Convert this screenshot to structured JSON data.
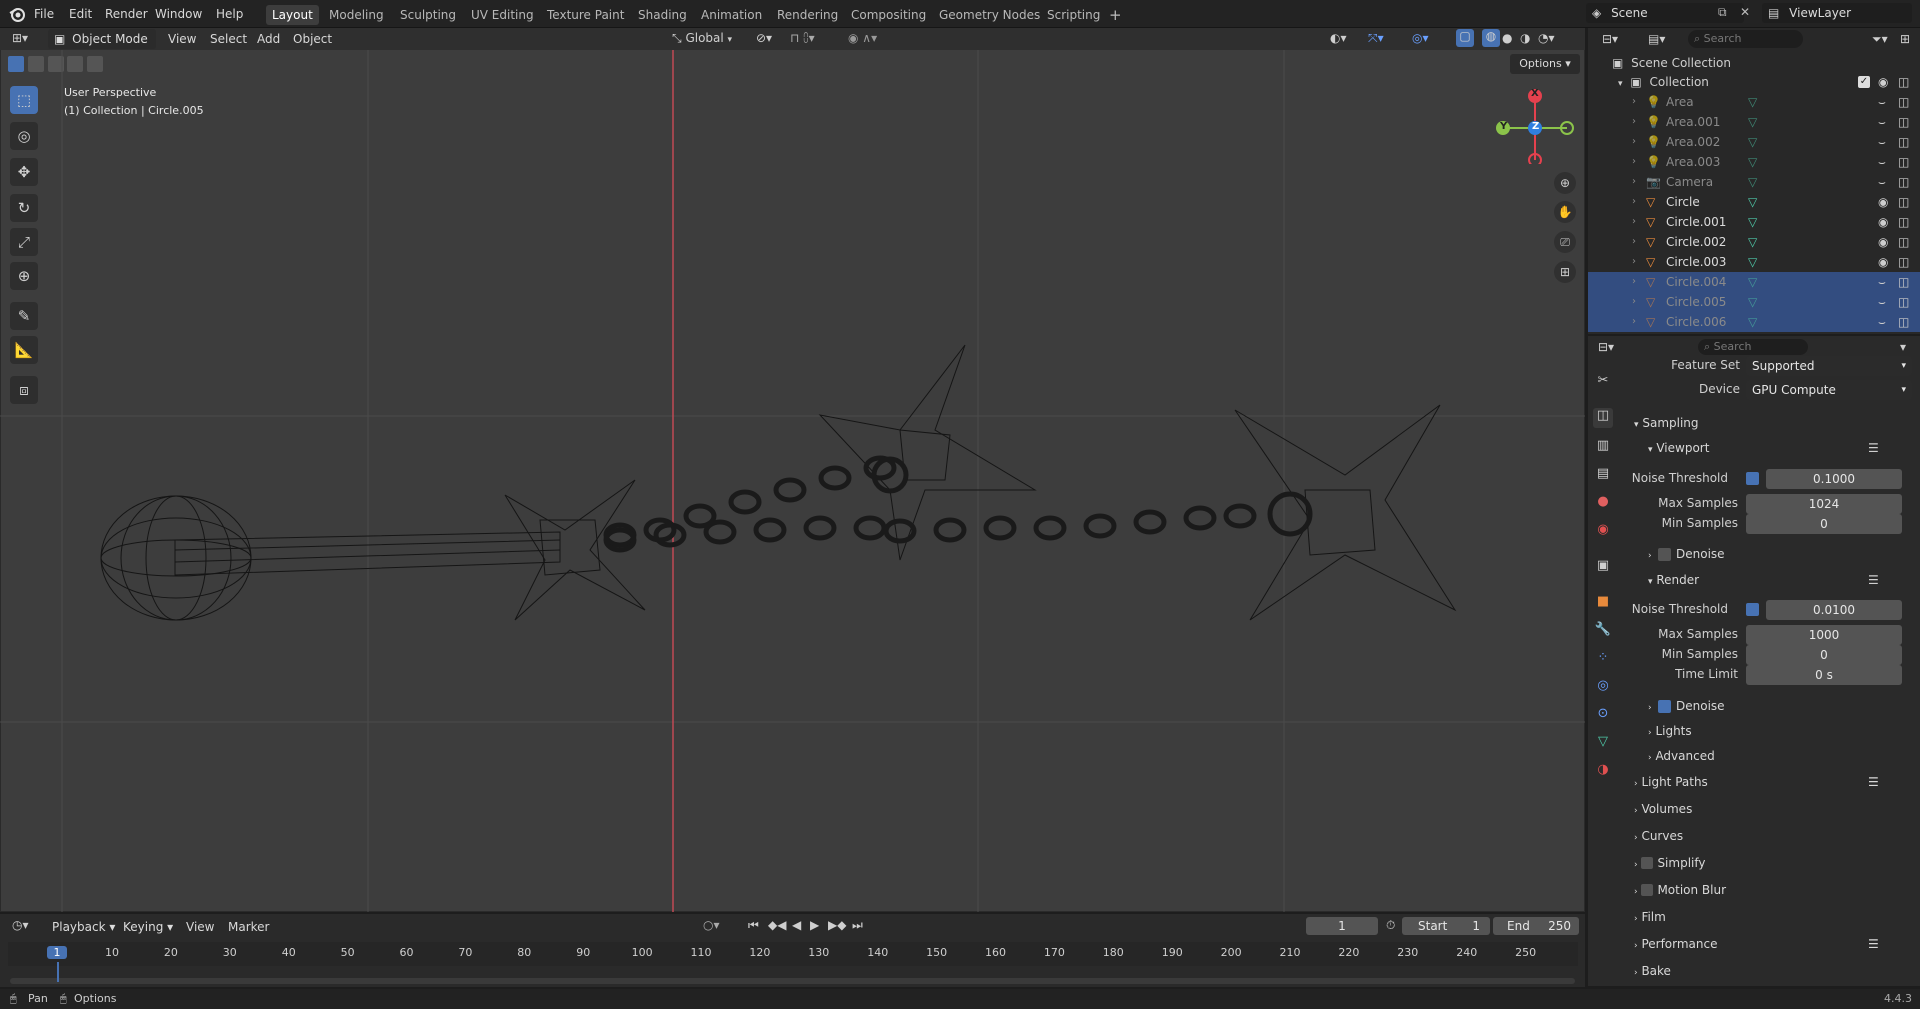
{
  "menu": [
    "File",
    "Edit",
    "Render",
    "Window",
    "Help"
  ],
  "workspaces": [
    "Layout",
    "Modeling",
    "Sculpting",
    "UV Editing",
    "Texture Paint",
    "Shading",
    "Animation",
    "Rendering",
    "Compositing",
    "Geometry Nodes",
    "Scripting"
  ],
  "scene_name": "Scene",
  "view_layer": "ViewLayer",
  "viewport": {
    "mode": "Object Mode",
    "menus": [
      "View",
      "Select",
      "Add",
      "Object"
    ],
    "transform_orientation": "Global",
    "options": "Options",
    "perspective": "User Perspective",
    "collection_info": "(1) Collection | Circle.005",
    "axes": {
      "x": "X",
      "y": "Y",
      "z": "Z"
    }
  },
  "outliner": {
    "search_placeholder": "Search",
    "scene_collection": "Scene Collection",
    "collection": "Collection",
    "items": [
      {
        "name": "Area",
        "type": "light"
      },
      {
        "name": "Area.001",
        "type": "light"
      },
      {
        "name": "Area.002",
        "type": "light"
      },
      {
        "name": "Area.003",
        "type": "light"
      },
      {
        "name": "Camera",
        "type": "camera"
      },
      {
        "name": "Circle",
        "type": "mesh"
      },
      {
        "name": "Circle.001",
        "type": "mesh"
      },
      {
        "name": "Circle.002",
        "type": "mesh"
      },
      {
        "name": "Circle.003",
        "type": "mesh"
      },
      {
        "name": "Circle.004",
        "type": "mesh"
      },
      {
        "name": "Circle.005",
        "type": "mesh"
      },
      {
        "name": "Circle.006",
        "type": "mesh"
      }
    ]
  },
  "properties": {
    "search_placeholder": "Search",
    "feature_set_label": "Feature Set",
    "feature_set": "Supported",
    "device_label": "Device",
    "device": "GPU Compute",
    "sampling": "Sampling",
    "viewport_sec": "Viewport",
    "noise_threshold_label": "Noise Threshold",
    "vp_noise_threshold": "0.1000",
    "max_samples_label": "Max Samples",
    "vp_max_samples": "1024",
    "min_samples_label": "Min Samples",
    "vp_min_samples": "0",
    "denoise": "Denoise",
    "render_sec": "Render",
    "r_noise_threshold": "0.0100",
    "r_max_samples": "1000",
    "r_min_samples": "0",
    "time_limit_label": "Time Limit",
    "r_time_limit": "0 s",
    "lights": "Lights",
    "advanced": "Advanced",
    "sections": [
      "Light Paths",
      "Volumes",
      "Curves",
      "Simplify",
      "Motion Blur",
      "Film",
      "Performance",
      "Bake"
    ]
  },
  "timeline": {
    "menus": [
      "Playback",
      "Keying",
      "View",
      "Marker"
    ],
    "current_frame": "1",
    "start_label": "Start",
    "start": "1",
    "end_label": "End",
    "end": "250",
    "ticks": [
      "1",
      "10",
      "20",
      "30",
      "40",
      "50",
      "60",
      "70",
      "80",
      "90",
      "100",
      "110",
      "120",
      "130",
      "140",
      "150",
      "160",
      "170",
      "180",
      "190",
      "200",
      "210",
      "220",
      "230",
      "240",
      "250"
    ]
  },
  "status": {
    "pan": "Pan",
    "options": "Options",
    "version": "4.4.3"
  },
  "colors": {
    "accent": "#4772b3",
    "selected_row": "#334d80",
    "x_axis": "#e5414e",
    "y_axis": "#8bc34a",
    "z_axis": "#2f7fe0",
    "mesh_icon": "#e88a3c",
    "light_icon": "#c9903a",
    "data_icon": "#4fc9a8"
  }
}
